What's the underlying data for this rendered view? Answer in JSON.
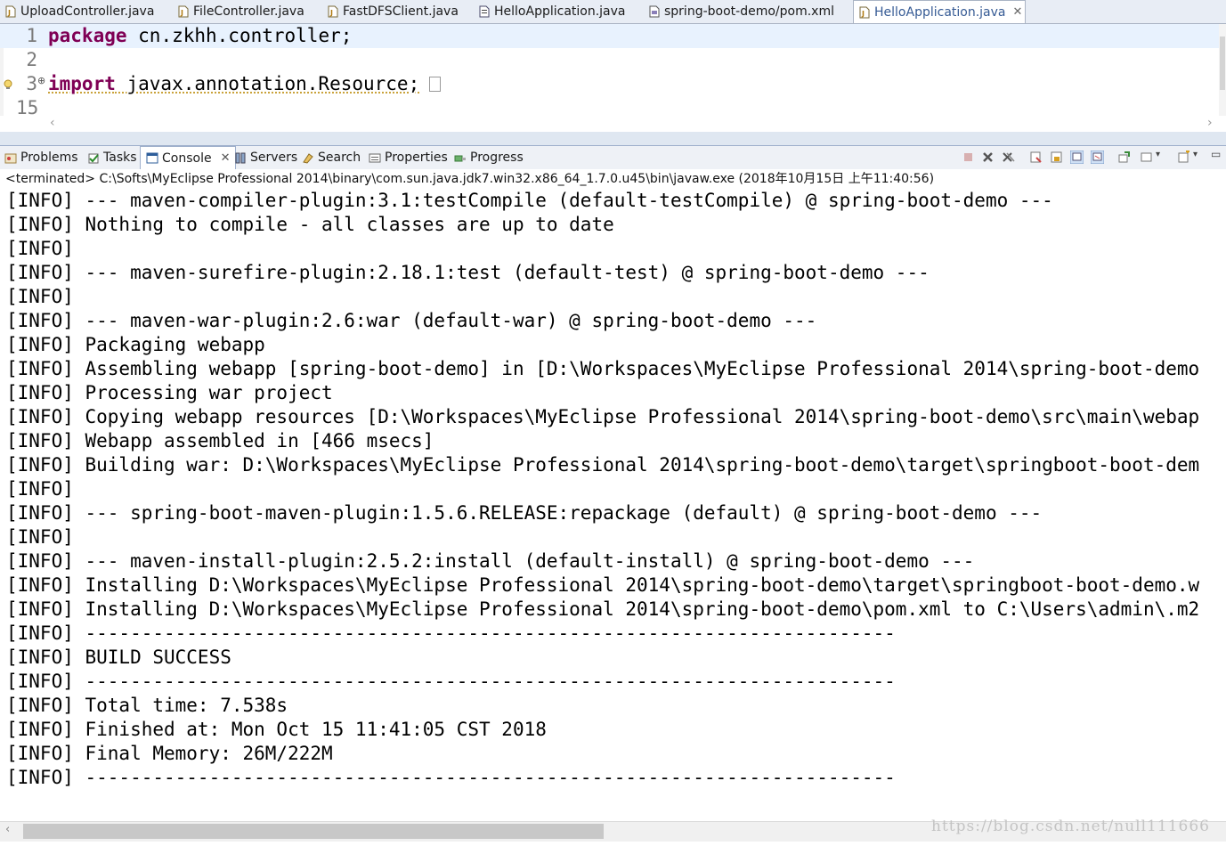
{
  "editor_tabs": [
    {
      "label": "UploadController.java"
    },
    {
      "label": "FileController.java"
    },
    {
      "label": "FastDFSClient.java"
    },
    {
      "label": "HelloApplication.java"
    },
    {
      "label": "spring-boot-demo/pom.xml"
    },
    {
      "label": "HelloApplication.java",
      "active": true,
      "close": "✕"
    }
  ],
  "editor": {
    "lines": [
      {
        "num": "1",
        "keyword": "package",
        "text": " cn.zkhh.controller;"
      },
      {
        "num": "2",
        "keyword": "",
        "text": ""
      },
      {
        "num": "3",
        "keyword": "import",
        "text": " javax.annotation.Resource;"
      },
      {
        "num": "15",
        "keyword": "",
        "text": ""
      }
    ]
  },
  "view_tabs": [
    {
      "label": "Problems",
      "icon": "problems-icon"
    },
    {
      "label": "Tasks",
      "icon": "tasks-icon"
    },
    {
      "label": "Console",
      "icon": "console-icon",
      "active": true,
      "close": "✕"
    },
    {
      "label": "Servers",
      "icon": "servers-icon"
    },
    {
      "label": "Search",
      "icon": "search-icon"
    },
    {
      "label": "Properties",
      "icon": "properties-icon"
    },
    {
      "label": "Progress",
      "icon": "progress-icon"
    }
  ],
  "console": {
    "header": "<terminated> C:\\Softs\\MyEclipse Professional 2014\\binary\\com.sun.java.jdk7.win32.x86_64_1.7.0.u45\\bin\\javaw.exe (2018年10月15日 上午11:40:56)",
    "lines": [
      "[INFO] --- maven-compiler-plugin:3.1:testCompile (default-testCompile) @ spring-boot-demo ---",
      "[INFO] Nothing to compile - all classes are up to date",
      "[INFO]",
      "[INFO] --- maven-surefire-plugin:2.18.1:test (default-test) @ spring-boot-demo ---",
      "[INFO]",
      "[INFO] --- maven-war-plugin:2.6:war (default-war) @ spring-boot-demo ---",
      "[INFO] Packaging webapp",
      "[INFO] Assembling webapp [spring-boot-demo] in [D:\\Workspaces\\MyEclipse Professional 2014\\spring-boot-demo",
      "[INFO] Processing war project",
      "[INFO] Copying webapp resources [D:\\Workspaces\\MyEclipse Professional 2014\\spring-boot-demo\\src\\main\\webap",
      "[INFO] Webapp assembled in [466 msecs]",
      "[INFO] Building war: D:\\Workspaces\\MyEclipse Professional 2014\\spring-boot-demo\\target\\springboot-boot-dem",
      "[INFO]",
      "[INFO] --- spring-boot-maven-plugin:1.5.6.RELEASE:repackage (default) @ spring-boot-demo ---",
      "[INFO]",
      "[INFO] --- maven-install-plugin:2.5.2:install (default-install) @ spring-boot-demo ---",
      "[INFO] Installing D:\\Workspaces\\MyEclipse Professional 2014\\spring-boot-demo\\target\\springboot-boot-demo.w",
      "[INFO] Installing D:\\Workspaces\\MyEclipse Professional 2014\\spring-boot-demo\\pom.xml to C:\\Users\\admin\\.m2",
      "[INFO] ------------------------------------------------------------------------",
      "[INFO] BUILD SUCCESS",
      "[INFO] ------------------------------------------------------------------------",
      "[INFO] Total time: 7.538s",
      "[INFO] Finished at: Mon Oct 15 11:41:05 CST 2018",
      "[INFO] Final Memory: 26M/222M",
      "[INFO] ------------------------------------------------------------------------"
    ]
  },
  "watermark": "https://blog.csdn.net/null111666",
  "colors": {
    "keyword": "#7f0055",
    "active_tab_text": "#355a94",
    "current_line": "#e8f2fe"
  }
}
